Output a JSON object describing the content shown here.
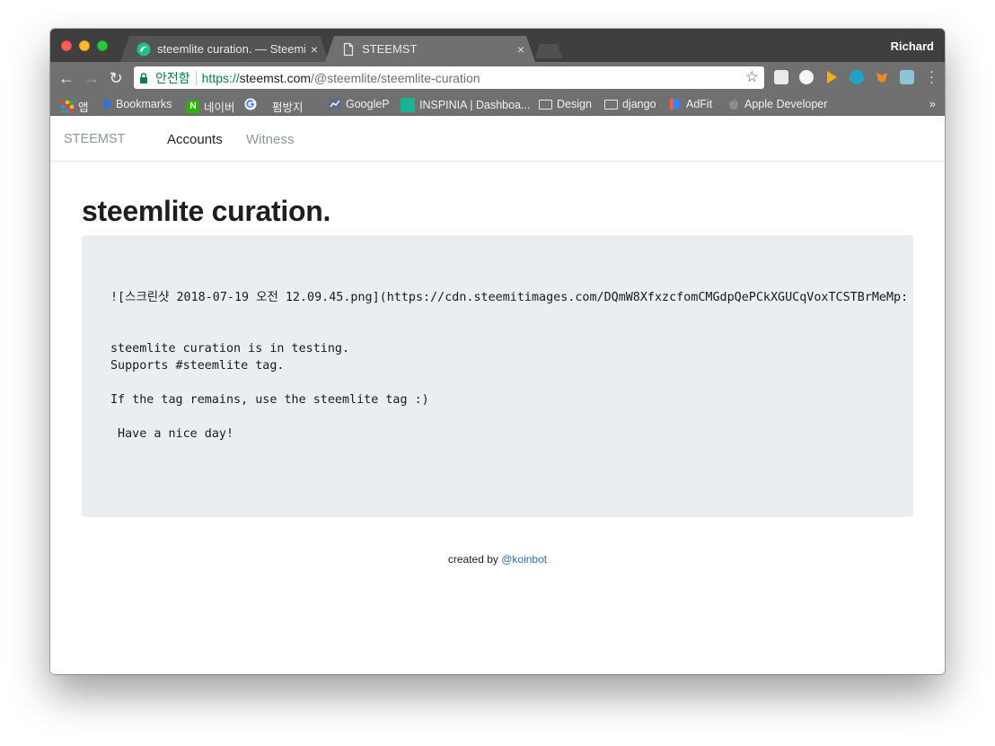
{
  "browser": {
    "profile_name": "Richard",
    "tabs": [
      {
        "label": "steemlite curation. — Steemit",
        "close": "×"
      },
      {
        "label": "STEEMST",
        "close": "×"
      }
    ],
    "address": {
      "secure_label": "안전함",
      "scheme": "https://",
      "host": "steemst.com",
      "path": "/@steemlite/steemlite-curation"
    },
    "bookmarks": [
      {
        "label": "앱",
        "icon": "apps-grid-icon"
      },
      {
        "label": "Bookmarks",
        "icon": "bookmark-icon"
      },
      {
        "label": "네이버",
        "icon": "naver-icon"
      },
      {
        "label": "",
        "icon": "google-icon"
      },
      {
        "label": "펌방지",
        "icon": "page-icon"
      },
      {
        "label": "GoogleP",
        "icon": "chart-icon"
      },
      {
        "label": "INSPINIA | Dashboa...",
        "icon": "inspinia-icon"
      },
      {
        "label": "Design",
        "icon": "folder-icon"
      },
      {
        "label": "django",
        "icon": "folder-icon"
      },
      {
        "label": "AdFit",
        "icon": "adfit-icon"
      },
      {
        "label": "Apple Developer",
        "icon": "apple-icon"
      }
    ],
    "bookmarks_more": "»"
  },
  "site": {
    "brand": "STEEMST",
    "nav": [
      {
        "label": "Accounts"
      },
      {
        "label": "Witness"
      }
    ]
  },
  "post": {
    "title": "steemlite curation.",
    "body": "![스크린샷 2018-07-19 오전 12.09.45.png](https://cdn.steemitimages.com/DQmW8XfxzcfomCMGdpQePCkXGUCqVoxTCSTBrMeMp:\n\n\nsteemlite curation is in testing.\nSupports #steemlite tag.\n\nIf the tag remains, use the steemlite tag :)\n\n Have a nice day!"
  },
  "footer": {
    "prefix": "created by ",
    "author": "@koinbot"
  },
  "colors": {
    "titlebar": "#3f3f3f",
    "toolbar": "#707070",
    "secure_green": "#0b8043",
    "post_bg": "#ebeef0",
    "link_blue": "#2b6fa8"
  }
}
